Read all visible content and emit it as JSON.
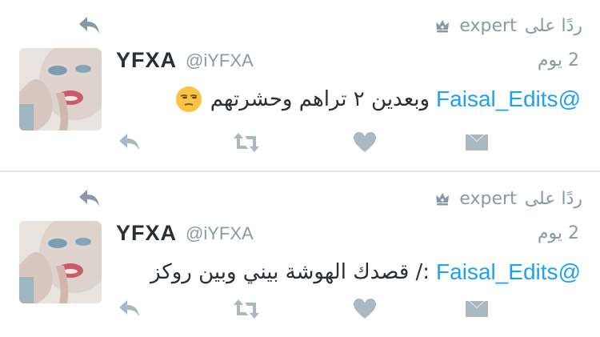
{
  "tweets": [
    {
      "context_user": "expert",
      "context_label": "ردًا على",
      "name": "YFXA",
      "handle": "@iYFXA",
      "time": "2 يوم",
      "mention": "@Faisal_Edits",
      "text": "وبعدين ٢ تراهم وحشرتهم",
      "emoji": "unamused-face"
    },
    {
      "context_user": "expert",
      "context_label": "ردًا على",
      "name": "YFXA",
      "handle": "@iYFXA",
      "time": "2 يوم",
      "mention": "@Faisal_Edits",
      "text": ":/ قصدك الهوشة بيني وبين روكز",
      "emoji": ""
    }
  ],
  "icons": {
    "reply_indicator": "reply-arrow-icon",
    "context": "crown-icon",
    "actions": [
      "reply-icon",
      "retweet-icon",
      "like-icon",
      "direct-message-icon"
    ]
  },
  "colors": {
    "link": "#1da1f2",
    "muted": "#8899a6",
    "action_icon": "#aab8c2",
    "text": "#292f33",
    "divider": "#e1e8ed"
  }
}
